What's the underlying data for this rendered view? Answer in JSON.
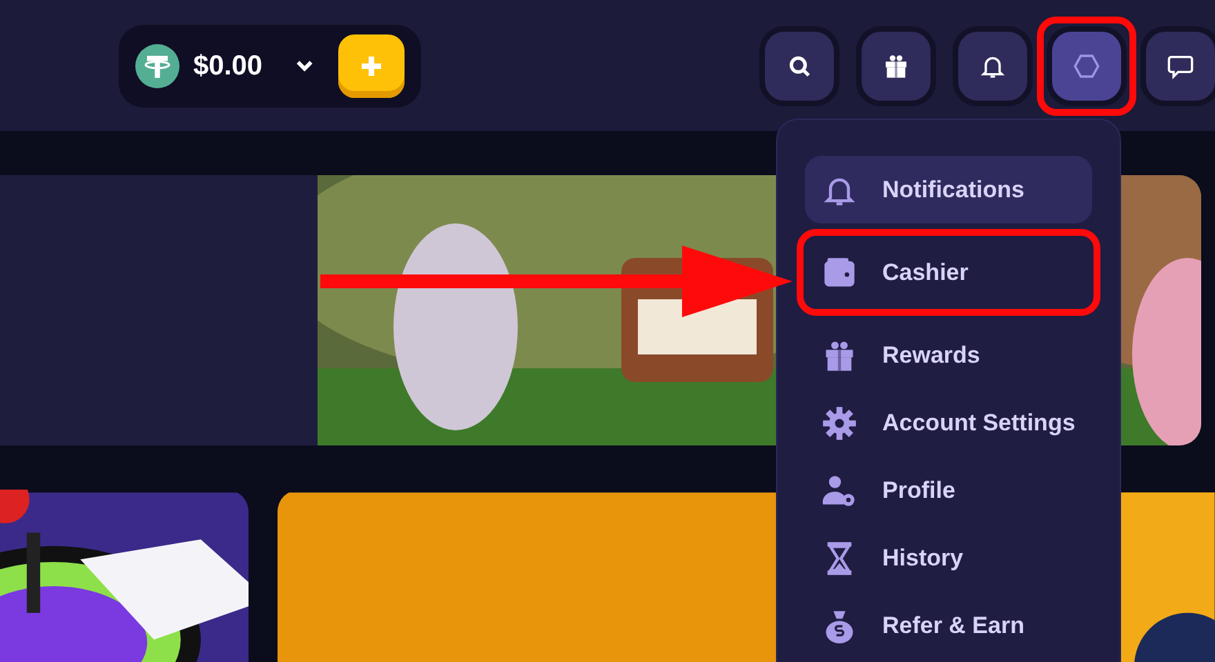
{
  "balance": {
    "amount": "$0.00"
  },
  "header_buttons": [
    {
      "kind": "search",
      "selected": false,
      "highlighted": false
    },
    {
      "kind": "gift",
      "selected": false,
      "highlighted": false
    },
    {
      "kind": "bell",
      "selected": false,
      "highlighted": false
    },
    {
      "kind": "hexagon",
      "selected": true,
      "highlighted": true
    },
    {
      "kind": "chat",
      "selected": false,
      "highlighted": false
    }
  ],
  "menu": {
    "items": [
      {
        "label": "Notifications",
        "kind": "bell",
        "selected": true,
        "highlighted": false
      },
      {
        "label": "Cashier",
        "kind": "wallet",
        "selected": false,
        "highlighted": true
      },
      {
        "label": "Rewards",
        "kind": "gift",
        "selected": false,
        "highlighted": false
      },
      {
        "label": "Account Settings",
        "kind": "gear",
        "selected": false,
        "highlighted": false
      },
      {
        "label": "Profile",
        "kind": "user",
        "selected": false,
        "highlighted": false
      },
      {
        "label": "History",
        "kind": "hourglass",
        "selected": false,
        "highlighted": false
      },
      {
        "label": "Refer & Earn",
        "kind": "bag",
        "selected": false,
        "highlighted": false
      }
    ]
  }
}
